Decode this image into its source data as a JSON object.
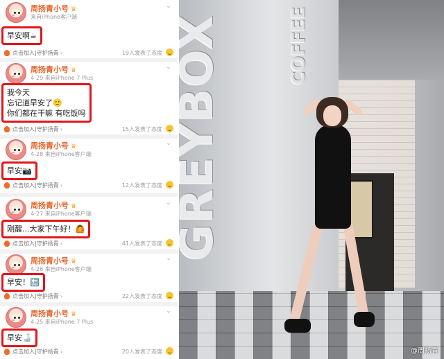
{
  "posts": [
    {
      "username": "周扬青小号",
      "time": "",
      "source": "来自iPhone客户端",
      "content_lines": [
        "早安啊☕"
      ],
      "guard_link": "点击加入|守护扬青",
      "reactions": "19人发表了态度"
    },
    {
      "username": "周扬青小号",
      "time": "4-29",
      "source": "来自iPhone 7 Plus",
      "content_lines": [
        "我今天",
        "忘记道早安了🙂",
        "你们都在干嘛 有吃饭吗"
      ],
      "guard_link": "点击加入|守护扬青",
      "reactions": "15人发表了态度"
    },
    {
      "username": "周扬青小号",
      "time": "4-28",
      "source": "来自iPhone客户端",
      "content_lines": [
        "早安📷"
      ],
      "guard_link": "点击加入|守护扬青",
      "reactions": "12人发表了态度"
    },
    {
      "username": "周扬青小号",
      "time": "4-27",
      "source": "来自iPhone客户端",
      "content_lines": [
        "刚醒...大家下午好！🙆"
      ],
      "guard_link": "点击加入|守护扬青",
      "reactions": "41人发表了态度"
    },
    {
      "username": "周扬青小号",
      "time": "4-26",
      "source": "来自iPhone客户端",
      "content_lines": [
        "早安！🔚"
      ],
      "guard_link": "点击加入|守护扬青",
      "reactions": "22人发表了态度"
    },
    {
      "username": "周扬青小号",
      "time": "4-25",
      "source": "来自iPhone 7 Plus",
      "content_lines": [
        "早安🍶"
      ],
      "guard_link": "点击加入|守护扬青",
      "reactions": "20人发表了态度"
    }
  ],
  "photo": {
    "sign_main": "GREYBOX",
    "sign_sub": "COFFEE",
    "watermark": "@周扬青"
  },
  "colors": {
    "highlight_border": "#e3141b",
    "username": "#e8672c"
  }
}
